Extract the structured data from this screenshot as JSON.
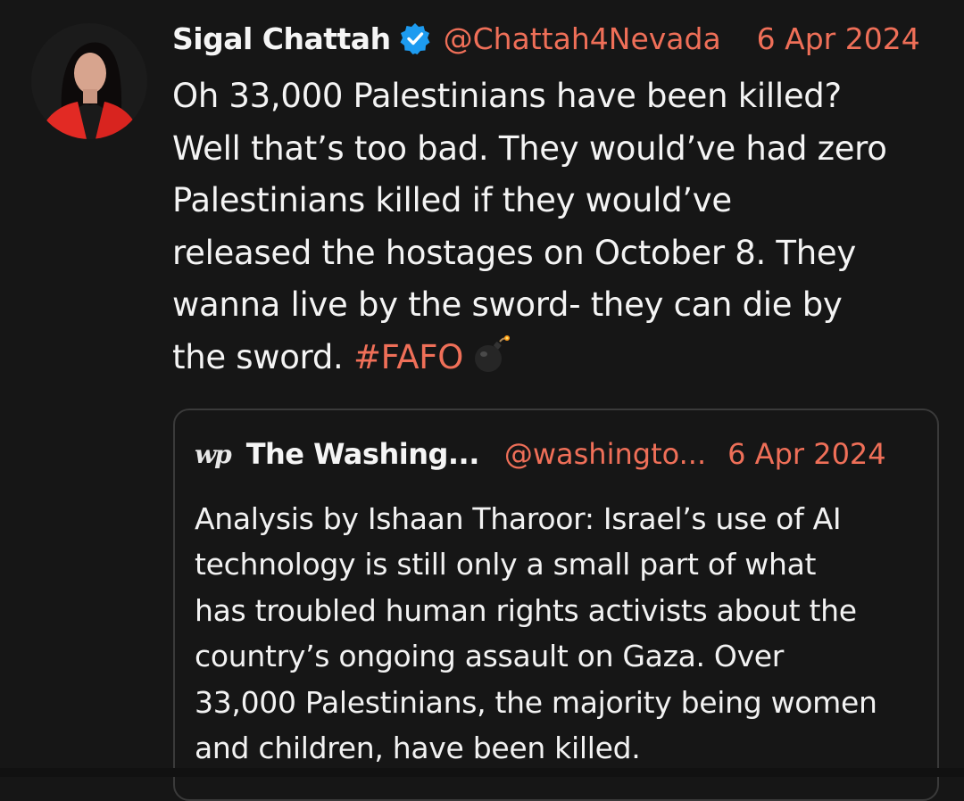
{
  "tweet": {
    "author_name": "Sigal Chattah",
    "handle": "@Chattah4Nevada",
    "date": "6 Apr 2024",
    "body_lines": [
      "Oh 33,000 Palestinians have been killed?",
      "Well that’s too bad. They would’ve had zero",
      "Palestinians killed if they would’ve",
      "released the hostages on October 8. They",
      "wanna live by the sword- they can die by"
    ],
    "last_line_text": "the sword.",
    "hashtag": "#FAFO",
    "emoji_icon": "bomb-icon"
  },
  "quote": {
    "logo": "wp",
    "author_name": "The Washing...",
    "handle": "@washingto...",
    "date": "6 Apr 2024",
    "body_lines": [
      "Analysis by Ishaan Tharoor: Israel’s use of AI",
      "technology is still only a small part of what",
      "has troubled human rights activists about the",
      "country’s ongoing assault on Gaza. Over",
      "33,000 Palestinians, the majority being women",
      "and children, have been killed."
    ]
  },
  "colors": {
    "background": "#161616",
    "accent": "#ef6f58",
    "verified_blue": "#1d9bf0",
    "text": "#f4f4f4"
  }
}
